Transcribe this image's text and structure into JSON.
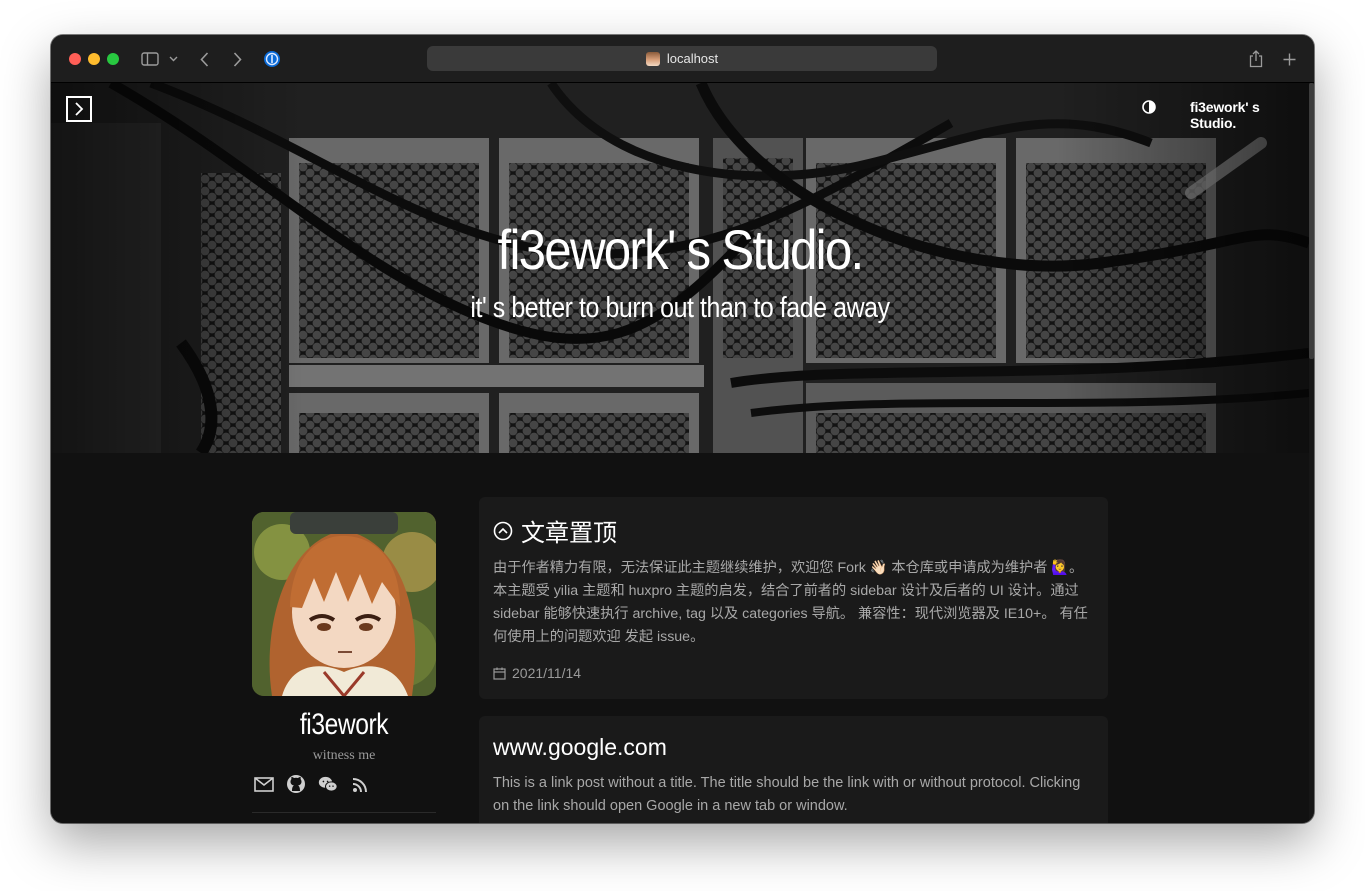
{
  "browser": {
    "address": "localhost"
  },
  "site": {
    "nav_brand": "fi3ework' s Studio.",
    "hero_title": "fi3ework' s Studio.",
    "hero_subtitle": "it' s better to burn out than to fade away"
  },
  "profile": {
    "name": "fi3ework",
    "motto": "witness me",
    "social_icons": [
      "mail-icon",
      "github-icon",
      "wechat-icon",
      "rss-icon"
    ]
  },
  "posts": [
    {
      "title": "文章置顶",
      "icon": "pin-up-icon",
      "body": "由于作者精力有限，无法保证此主题继续维护，欢迎您 Fork 👋🏻 本仓库或申请成为维护者 🙋‍♀️。 本主题受 yilia 主题和 huxpro 主题的启发，结合了前者的 sidebar 设计及后者的 UI 设计。通过 sidebar 能够快速执行 archive, tag 以及 categories 导航。 兼容性：现代浏览器及 IE10+。 有任何使用上的问题欢迎 发起 issue。",
      "date": "2021/11/14"
    },
    {
      "title": "www.google.com",
      "body": "This is a link post without a title. The title should be the link with or without protocol. Clicking on the link should open Google in a new tab or window."
    }
  ]
}
